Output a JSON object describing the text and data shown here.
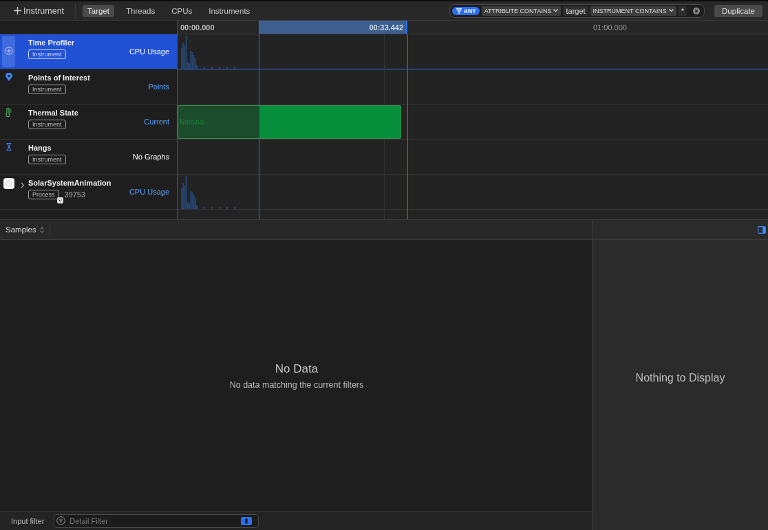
{
  "toolbar": {
    "add_button": "Instrument",
    "tabs": [
      {
        "label": "Target",
        "selected": true
      },
      {
        "label": "Threads",
        "selected": false
      },
      {
        "label": "CPUs",
        "selected": false
      },
      {
        "label": "Instruments",
        "selected": false
      }
    ],
    "filter": {
      "mode": "ANY",
      "tokens": [
        {
          "kind": "menu",
          "label": "ATTRIBUTE CONTAINS"
        },
        {
          "kind": "value",
          "label": "target"
        },
        {
          "kind": "menu",
          "label": "INSTRUMENT CONTAINS"
        },
        {
          "kind": "value",
          "label": "*"
        }
      ]
    },
    "duplicate_button": "Duplicate"
  },
  "ruler": {
    "start": "00:00.000",
    "selection_end": "00:33.442",
    "end": "01:00.000"
  },
  "tracks": [
    {
      "kind": "profiler",
      "name": "Time Profiler",
      "tag": "Instrument",
      "graph_label": "CPU Usage",
      "selected": true
    },
    {
      "kind": "points",
      "name": "Points of Interest",
      "tag": "Instrument",
      "graph_label": "Points",
      "selected": false
    },
    {
      "kind": "thermal",
      "name": "Thermal State",
      "tag": "Instrument",
      "graph_label": "Current",
      "state_label": "Nominal",
      "selected": false
    },
    {
      "kind": "hangs",
      "name": "Hangs",
      "tag": "Instrument",
      "graph_label": "No Graphs",
      "selected": false
    },
    {
      "kind": "process",
      "name": "SolarSystemAnimation",
      "tag": "Process",
      "pid": "39753",
      "expanded": false,
      "graph_label": "CPU Usage",
      "selected": false
    }
  ],
  "detail": {
    "view_menu": "Samples",
    "empty_title": "No Data",
    "empty_message": "No data matching the current filters"
  },
  "inspector": {
    "empty_message": "Nothing to Display"
  },
  "filter_bar": {
    "label": "Input filter",
    "placeholder": "Detail Filter"
  }
}
